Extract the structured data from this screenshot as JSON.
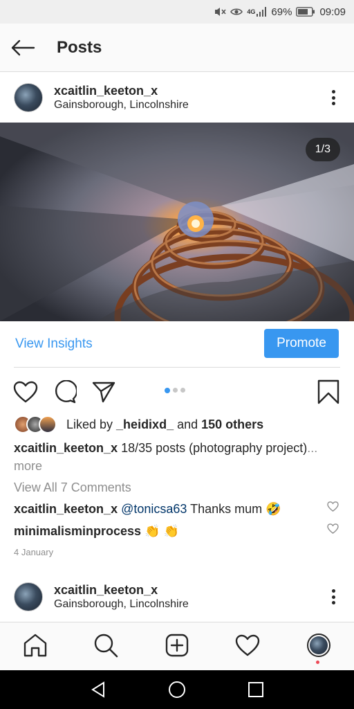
{
  "status_bar": {
    "network": "4G",
    "battery_percent": "69%",
    "time": "09:09"
  },
  "header": {
    "title": "Posts",
    "back_icon": "arrow-left-icon"
  },
  "post": {
    "username": "xcaitlin_keeton_x",
    "location": "Gainsborough, Lincolnshire",
    "image_counter": "1/3",
    "current_image": 1,
    "image_count": 3,
    "view_insights": "View Insights",
    "promote": "Promote",
    "likes": {
      "prefix": "Liked by ",
      "first_user": "_heidixd_",
      "middle": " and ",
      "others": "150 others"
    },
    "caption": {
      "user": "xcaitlin_keeton_x",
      "text": " 18/35 posts (photography project)",
      "more": "... more"
    },
    "view_all_comments": "View All 7 Comments",
    "comments": [
      {
        "user": "xcaitlin_keeton_x",
        "mention": "@tonicsa63",
        "text": " Thanks mum 🤣"
      },
      {
        "user": "minimalisminprocess",
        "mention": "",
        "text": " 👏 👏"
      }
    ],
    "date": "4 January"
  },
  "next_post": {
    "username": "xcaitlin_keeton_x",
    "location": "Gainsborough, Lincolnshire"
  },
  "colors": {
    "accent": "#3897f0",
    "text": "#262626",
    "muted": "#8e8e8e",
    "notification": "#ed4956"
  },
  "bottom_nav": [
    "home-icon",
    "search-icon",
    "add-post-icon",
    "activity-heart-icon",
    "profile-avatar"
  ]
}
